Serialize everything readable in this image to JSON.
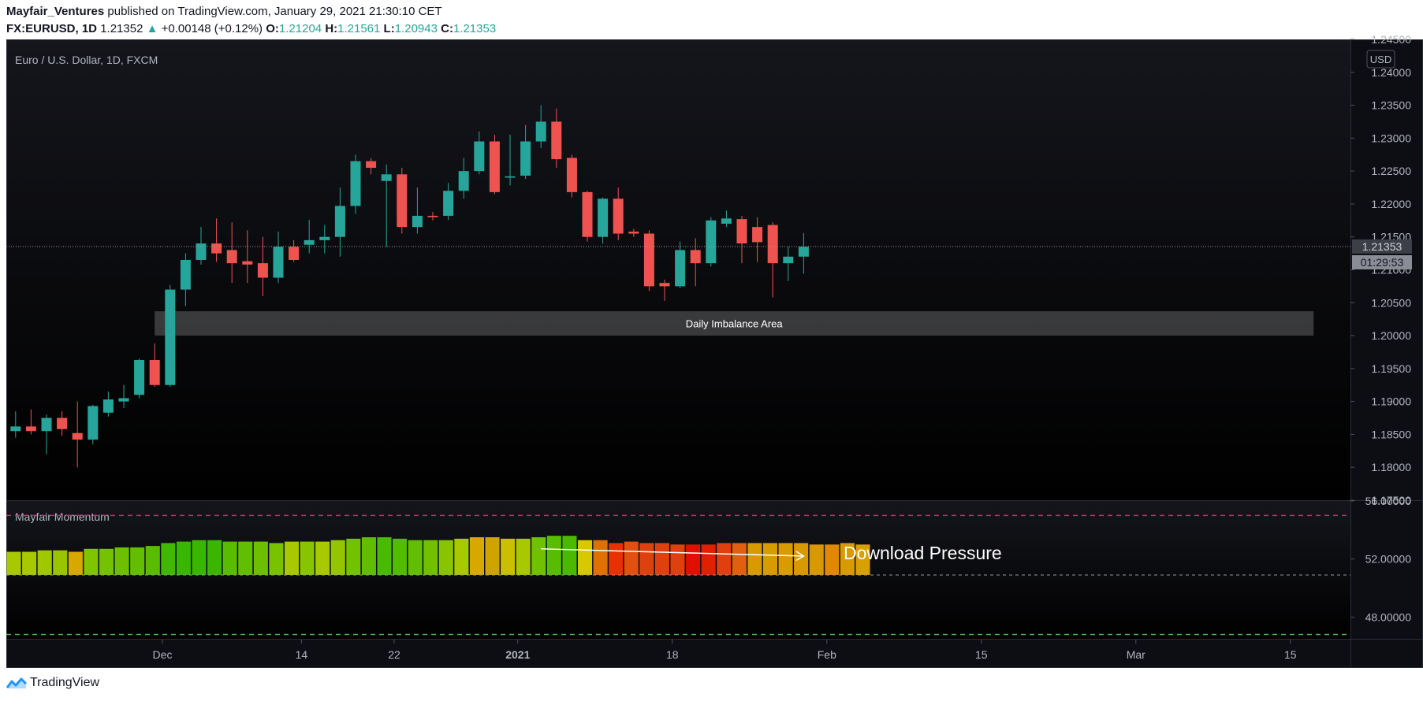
{
  "header": {
    "author": "Mayfair_Ventures",
    "published": "published on TradingView.com, January 29, 2021 21:30:10 CET",
    "symbol": "FX:EURUSD, 1D",
    "last": "1.21352",
    "change": "+0.00148 (+0.12%)",
    "o_label": "O:",
    "o": "1.21204",
    "h_label": "H:",
    "h": "1.21561",
    "l_label": "L:",
    "l": "1.20943",
    "c_label": "C:",
    "c": "1.21353"
  },
  "footer": {
    "brand": "TradingView"
  },
  "colors": {
    "up": "#26a69a",
    "down": "#ef5350",
    "background": "#0d0e13",
    "text": "#b2b5be"
  },
  "chart_data": [
    {
      "type": "candlestick",
      "title": "Euro / U.S. Dollar, 1D, FXCM",
      "currency": "USD",
      "ylim": [
        1.175,
        1.245
      ],
      "y_ticks": [
        "1.24500",
        "1.24000",
        "1.23500",
        "1.23000",
        "1.22500",
        "1.22000",
        "1.21500",
        "1.21000",
        "1.20500",
        "1.20000",
        "1.19500",
        "1.19000",
        "1.18500",
        "1.18000",
        "1.17500"
      ],
      "x_tick_labels": [
        {
          "label": "Dec",
          "index": 9.5
        },
        {
          "label": "14",
          "index": 18.5
        },
        {
          "label": "22",
          "index": 24.5
        },
        {
          "label": "2021",
          "index": 32.5
        },
        {
          "label": "18",
          "index": 42.5
        },
        {
          "label": "Feb",
          "index": 52.5
        },
        {
          "label": "15",
          "index": 62.5
        },
        {
          "label": "Mar",
          "index": 72.5
        },
        {
          "label": "15",
          "index": 82.5
        }
      ],
      "x_range": [
        0,
        87.5
      ],
      "last_price_label": "1.21353",
      "countdown_label": "01:29:53",
      "last_price": 1.21353,
      "zone": {
        "label": "Daily Imbalance Area",
        "y_top": 1.2037,
        "y_bottom": 1.2,
        "x_start": 9.0,
        "x_end": 84.0
      },
      "candles": [
        {
          "o": 1.1855,
          "h": 1.1885,
          "l": 1.1845,
          "c": 1.1862
        },
        {
          "o": 1.1862,
          "h": 1.1888,
          "l": 1.185,
          "c": 1.1855
        },
        {
          "o": 1.1855,
          "h": 1.188,
          "l": 1.182,
          "c": 1.1875
        },
        {
          "o": 1.1875,
          "h": 1.1885,
          "l": 1.1848,
          "c": 1.1858
        },
        {
          "o": 1.1852,
          "h": 1.19,
          "l": 1.18,
          "c": 1.1842
        },
        {
          "o": 1.1842,
          "h": 1.1895,
          "l": 1.1835,
          "c": 1.1893
        },
        {
          "o": 1.1883,
          "h": 1.1915,
          "l": 1.1877,
          "c": 1.1903
        },
        {
          "o": 1.19,
          "h": 1.1925,
          "l": 1.189,
          "c": 1.1905
        },
        {
          "o": 1.191,
          "h": 1.1965,
          "l": 1.1905,
          "c": 1.1963
        },
        {
          "o": 1.1963,
          "h": 1.1988,
          "l": 1.1922,
          "c": 1.1925
        },
        {
          "o": 1.1925,
          "h": 1.2077,
          "l": 1.1922,
          "c": 1.207
        },
        {
          "o": 1.207,
          "h": 1.2125,
          "l": 1.2045,
          "c": 1.2115
        },
        {
          "o": 1.2115,
          "h": 1.2165,
          "l": 1.2108,
          "c": 1.214
        },
        {
          "o": 1.214,
          "h": 1.2178,
          "l": 1.2112,
          "c": 1.2125
        },
        {
          "o": 1.213,
          "h": 1.2172,
          "l": 1.208,
          "c": 1.211
        },
        {
          "o": 1.2113,
          "h": 1.216,
          "l": 1.208,
          "c": 1.2108
        },
        {
          "o": 1.211,
          "h": 1.215,
          "l": 1.206,
          "c": 1.2088
        },
        {
          "o": 1.2088,
          "h": 1.2158,
          "l": 1.208,
          "c": 1.2135
        },
        {
          "o": 1.2135,
          "h": 1.2145,
          "l": 1.2112,
          "c": 1.2115
        },
        {
          "o": 1.2138,
          "h": 1.2176,
          "l": 1.2125,
          "c": 1.2145
        },
        {
          "o": 1.2145,
          "h": 1.2168,
          "l": 1.2125,
          "c": 1.215
        },
        {
          "o": 1.215,
          "h": 1.2225,
          "l": 1.212,
          "c": 1.2197
        },
        {
          "o": 1.2197,
          "h": 1.2275,
          "l": 1.2185,
          "c": 1.2265
        },
        {
          "o": 1.2265,
          "h": 1.227,
          "l": 1.2245,
          "c": 1.2255
        },
        {
          "o": 1.2235,
          "h": 1.226,
          "l": 1.2135,
          "c": 1.2245
        },
        {
          "o": 1.2245,
          "h": 1.2255,
          "l": 1.2155,
          "c": 1.2165
        },
        {
          "o": 1.2165,
          "h": 1.2225,
          "l": 1.2155,
          "c": 1.2182
        },
        {
          "o": 1.2182,
          "h": 1.2188,
          "l": 1.2175,
          "c": 1.218
        },
        {
          "o": 1.2182,
          "h": 1.2232,
          "l": 1.2176,
          "c": 1.222
        },
        {
          "o": 1.222,
          "h": 1.227,
          "l": 1.2208,
          "c": 1.225
        },
        {
          "o": 1.225,
          "h": 1.231,
          "l": 1.2245,
          "c": 1.2295
        },
        {
          "o": 1.2295,
          "h": 1.2305,
          "l": 1.2215,
          "c": 1.2218
        },
        {
          "o": 1.224,
          "h": 1.2305,
          "l": 1.2228,
          "c": 1.2242
        },
        {
          "o": 1.2243,
          "h": 1.232,
          "l": 1.2238,
          "c": 1.2295
        },
        {
          "o": 1.2295,
          "h": 1.235,
          "l": 1.2285,
          "c": 1.2325
        },
        {
          "o": 1.2325,
          "h": 1.2345,
          "l": 1.2255,
          "c": 1.2268
        },
        {
          "o": 1.227,
          "h": 1.2275,
          "l": 1.221,
          "c": 1.2218
        },
        {
          "o": 1.2218,
          "h": 1.222,
          "l": 1.2143,
          "c": 1.215
        },
        {
          "o": 1.215,
          "h": 1.221,
          "l": 1.214,
          "c": 1.2208
        },
        {
          "o": 1.2208,
          "h": 1.2225,
          "l": 1.2145,
          "c": 1.2155
        },
        {
          "o": 1.2158,
          "h": 1.2162,
          "l": 1.215,
          "c": 1.2155
        },
        {
          "o": 1.2155,
          "h": 1.216,
          "l": 1.2068,
          "c": 1.2075
        },
        {
          "o": 1.208,
          "h": 1.2085,
          "l": 1.2053,
          "c": 1.2075
        },
        {
          "o": 1.2075,
          "h": 1.2143,
          "l": 1.2072,
          "c": 1.213
        },
        {
          "o": 1.213,
          "h": 1.2148,
          "l": 1.2075,
          "c": 1.211
        },
        {
          "o": 1.211,
          "h": 1.218,
          "l": 1.2105,
          "c": 1.2175
        },
        {
          "o": 1.217,
          "h": 1.219,
          "l": 1.2165,
          "c": 1.2178
        },
        {
          "o": 1.2177,
          "h": 1.2182,
          "l": 1.211,
          "c": 1.214
        },
        {
          "o": 1.2165,
          "h": 1.218,
          "l": 1.2112,
          "c": 1.2142
        },
        {
          "o": 1.2168,
          "h": 1.2172,
          "l": 1.2058,
          "c": 1.211
        },
        {
          "o": 1.211,
          "h": 1.2135,
          "l": 1.2083,
          "c": 1.212
        },
        {
          "o": 1.212,
          "h": 1.2156,
          "l": 1.2094,
          "c": 1.2135
        }
      ]
    },
    {
      "type": "bar",
      "title": "Mayfair Momentum",
      "ylim": [
        46.5,
        56.0
      ],
      "y_ticks": [
        "56.00000",
        "52.00000",
        "48.00000"
      ],
      "baseline": 50.9,
      "upper_band": 55.0,
      "lower_band": 46.8,
      "annotation": "Download Pressure",
      "arrow": {
        "from": [
          34,
          52.7
        ],
        "to": [
          51,
          52.2
        ]
      },
      "values": [
        52.5,
        52.5,
        52.6,
        52.6,
        52.5,
        52.7,
        52.7,
        52.8,
        52.8,
        52.9,
        53.1,
        53.2,
        53.3,
        53.3,
        53.2,
        53.2,
        53.2,
        53.1,
        53.2,
        53.2,
        53.2,
        53.3,
        53.4,
        53.5,
        53.5,
        53.4,
        53.3,
        53.3,
        53.3,
        53.4,
        53.5,
        53.5,
        53.4,
        53.4,
        53.5,
        53.6,
        53.6,
        53.3,
        53.3,
        53.1,
        53.2,
        53.1,
        53.1,
        53.0,
        53.0,
        53.0,
        53.1,
        53.1,
        53.1,
        53.1,
        53.1,
        53.1,
        53.0,
        53.0,
        53.1,
        53.0
      ],
      "bar_colors": [
        "#a8c800",
        "#a8c800",
        "#a0c800",
        "#98c400",
        "#d8a800",
        "#80c400",
        "#74c200",
        "#6cc000",
        "#62be00",
        "#58bc00",
        "#40b800",
        "#38b600",
        "#38b600",
        "#3ab600",
        "#58bc00",
        "#62be00",
        "#6cc000",
        "#78c200",
        "#a8c800",
        "#88c400",
        "#a8c800",
        "#94c600",
        "#72c200",
        "#60be00",
        "#48ba00",
        "#52bc00",
        "#62be00",
        "#70c000",
        "#88c400",
        "#a8c800",
        "#d8a800",
        "#d0a400",
        "#c8c000",
        "#a8c800",
        "#70c200",
        "#58bc00",
        "#4ab900",
        "#d8c800",
        "#e07000",
        "#e83000",
        "#e05010",
        "#e04010",
        "#e04010",
        "#e04010",
        "#e01000",
        "#e02000",
        "#e04010",
        "#e06010",
        "#d89a00",
        "#d89c00",
        "#d89c00",
        "#d89a00",
        "#d89800",
        "#e08800",
        "#d89a00",
        "#d8a000"
      ]
    }
  ]
}
